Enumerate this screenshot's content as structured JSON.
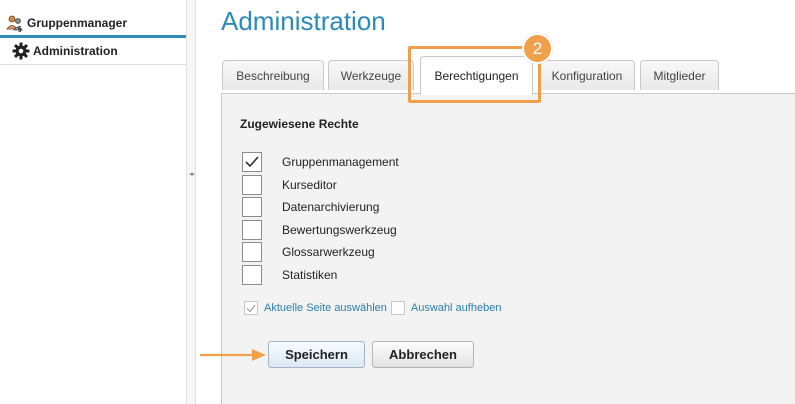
{
  "sidebar": {
    "group_label": "Gruppenmanager",
    "group_icon": "group-manager-icon",
    "items": [
      {
        "label": "Administration",
        "icon": "gear-icon"
      }
    ]
  },
  "main": {
    "title": "Administration",
    "tabs": [
      {
        "label": "Beschreibung"
      },
      {
        "label": "Werkzeuge"
      },
      {
        "label": "Berechtigungen",
        "active": true
      },
      {
        "label": "Konfiguration"
      },
      {
        "label": "Mitglieder"
      }
    ],
    "step_badge": "2",
    "section_title": "Zugewiesene Rechte",
    "permissions": [
      {
        "label": "Gruppenmanagement",
        "checked": true
      },
      {
        "label": "Kurseditor",
        "checked": false
      },
      {
        "label": "Datenarchivierung",
        "checked": false
      },
      {
        "label": "Bewertungswerkzeug",
        "checked": false
      },
      {
        "label": "Glossarwerkzeug",
        "checked": false
      },
      {
        "label": "Statistiken",
        "checked": false
      }
    ],
    "select_all_label": "Aktuelle Seite auswählen",
    "deselect_label": "Auswahl aufheben",
    "save_label": "Speichern",
    "cancel_label": "Abbrechen"
  },
  "colors": {
    "accent": "#2a8ab8",
    "highlight": "#f0a04b",
    "link": "#2a7fa8"
  }
}
